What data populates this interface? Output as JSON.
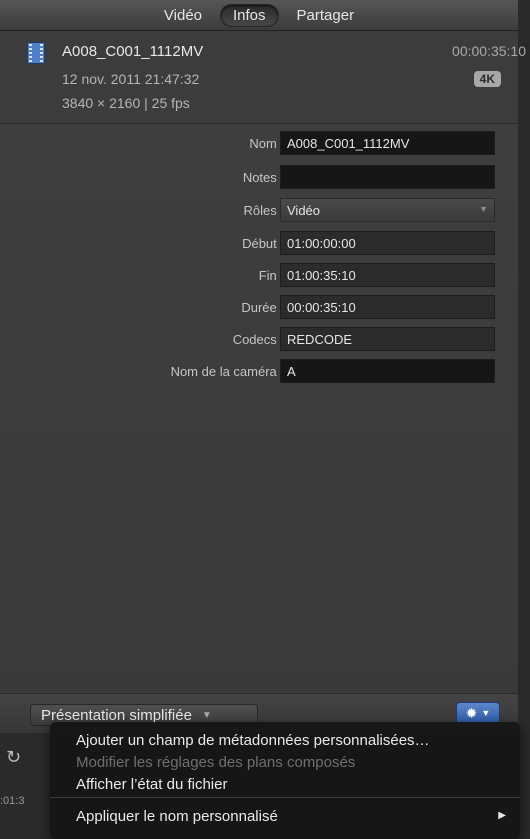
{
  "tabs": [
    {
      "label": "Vidéo",
      "active": false
    },
    {
      "label": "Infos",
      "active": true
    },
    {
      "label": "Partager",
      "active": false
    }
  ],
  "header": {
    "icon": "film-icon",
    "clip_name": "A008_C001_1112MV",
    "duration": "00:00:35:10",
    "date": "12 nov. 2011 21:47:32",
    "format": "3840 × 2160 | 25 fps",
    "badge": "4K"
  },
  "fields": [
    {
      "label": "Nom :",
      "value": "A008_C001_1112MV"
    },
    {
      "label": "Notes :",
      "value": ""
    },
    {
      "label": "Rôles :",
      "value": "Vidéo"
    },
    {
      "label": "Début :",
      "value": "01:00:00:00"
    },
    {
      "label": "Fin :",
      "value": "01:00:35:10"
    },
    {
      "label": "Durée :",
      "value": "00:00:35:10"
    },
    {
      "label": "Codecs :",
      "value": "REDCODE"
    },
    {
      "label": "Nom de la caméra :",
      "value": "A"
    }
  ],
  "bottom": {
    "view_button": "Présentation simplifiée"
  },
  "underlying": {
    "time_fragment": ":01:3"
  },
  "menu": {
    "items": [
      {
        "label": "Ajouter un champ de métadonnées personnalisées…",
        "enabled": true
      },
      {
        "label": "Modifier les réglages des plans composés",
        "enabled": false
      },
      {
        "label": "Afficher l’état du fichier",
        "enabled": true
      },
      {
        "label": "Appliquer le nom personnalisé",
        "enabled": true,
        "submenu": true
      }
    ]
  },
  "colors": {
    "accent": "#3e6fbf",
    "panel": "#3c3c3c",
    "field_bg": "#2b2b2b"
  }
}
